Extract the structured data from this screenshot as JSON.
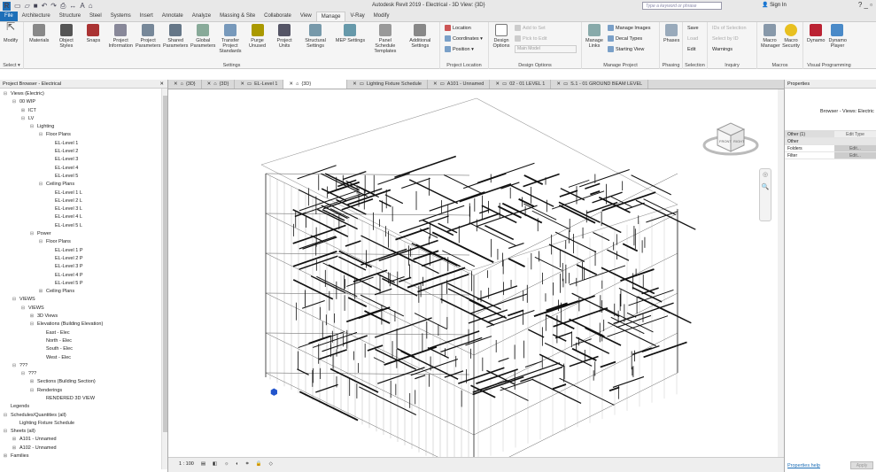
{
  "app": {
    "title": "Autodesk Revit 2019 - Electrical - 3D View: {3D}",
    "search_placeholder": "Type a keyword or phrase",
    "sign_in": "Sign In"
  },
  "ribbon_tabs": [
    "File",
    "Architecture",
    "Structure",
    "Steel",
    "Systems",
    "Insert",
    "Annotate",
    "Analyze",
    "Massing & Site",
    "Collaborate",
    "View",
    "Manage",
    "V-Ray",
    "Modify"
  ],
  "active_tab": "Manage",
  "panels": {
    "select": {
      "label": "Select ▾",
      "buttons": [
        "Modify"
      ]
    },
    "settings": {
      "label": "Settings",
      "buttons": [
        "Materials",
        "Object Styles",
        "Snaps",
        "Project Information",
        "Project Parameters",
        "Shared Parameters",
        "Global Parameters",
        "Transfer Project Standards",
        "Purge Unused",
        "Project Units",
        "Structural Settings",
        "MEP Settings",
        "Panel Schedule Templates",
        "Additional Settings"
      ]
    },
    "project_location": {
      "label": "Project Location",
      "items": [
        "Location",
        "Coordinates ▾",
        "Position ▾"
      ]
    },
    "design_options": {
      "label": "Design Options",
      "button": "Design Options",
      "items": [
        "Add to Set",
        "Pick to Edit"
      ],
      "dropdown": "Main Model"
    },
    "manage_project": {
      "label": "Manage Project",
      "button": "Manage Links",
      "items": [
        "Manage Images",
        "Decal Types",
        "Starting View"
      ]
    },
    "phasing": {
      "label": "Phasing",
      "button": "Phases"
    },
    "selection": {
      "label": "Selection",
      "items": [
        "Save",
        "Load",
        "Edit"
      ]
    },
    "inquiry": {
      "label": "Inquiry",
      "items": [
        "IDs of Selection",
        "Select by ID",
        "Warnings"
      ]
    },
    "macros": {
      "label": "Macros",
      "buttons": [
        "Macro Manager",
        "Macro Security"
      ]
    },
    "visual_programming": {
      "label": "Visual Programming",
      "buttons": [
        "Dynamo",
        "Dynamo Player"
      ]
    }
  },
  "project_browser": {
    "title": "Project Browser - Electrical",
    "items": [
      {
        "t": "Views (Electric)",
        "d": 0,
        "o": "-"
      },
      {
        "t": "00 WIP",
        "d": 1,
        "o": "-"
      },
      {
        "t": "ICT",
        "d": 2,
        "o": "+"
      },
      {
        "t": "LV",
        "d": 2,
        "o": "-"
      },
      {
        "t": "Lighting",
        "d": 3,
        "o": "-"
      },
      {
        "t": "Floor Plans",
        "d": 4,
        "o": "-"
      },
      {
        "t": "EL-Level 1",
        "d": 5
      },
      {
        "t": "EL-Level 2",
        "d": 5
      },
      {
        "t": "EL-Level 3",
        "d": 5
      },
      {
        "t": "EL-Level 4",
        "d": 5
      },
      {
        "t": "EL-Level 5",
        "d": 5
      },
      {
        "t": "Ceiling Plans",
        "d": 4,
        "o": "-"
      },
      {
        "t": "EL-Level 1 L",
        "d": 5
      },
      {
        "t": "EL-Level 2 L",
        "d": 5
      },
      {
        "t": "EL-Level 3 L",
        "d": 5
      },
      {
        "t": "EL-Level 4 L",
        "d": 5
      },
      {
        "t": "EL-Level 5 L",
        "d": 5
      },
      {
        "t": "Power",
        "d": 3,
        "o": "-"
      },
      {
        "t": "Floor Plans",
        "d": 4,
        "o": "-"
      },
      {
        "t": "EL-Level 1 P",
        "d": 5
      },
      {
        "t": "EL-Level 2 P",
        "d": 5
      },
      {
        "t": "EL-Level 3 P",
        "d": 5
      },
      {
        "t": "EL-Level 4 P",
        "d": 5
      },
      {
        "t": "EL-Level 5 P",
        "d": 5
      },
      {
        "t": "Ceiling Plans",
        "d": 4,
        "o": "+"
      },
      {
        "t": "VIEWS",
        "d": 1,
        "o": "-"
      },
      {
        "t": "VIEWS",
        "d": 2,
        "o": "-"
      },
      {
        "t": "3D Views",
        "d": 3,
        "o": "+"
      },
      {
        "t": "Elevations (Building Elevation)",
        "d": 3,
        "o": "-"
      },
      {
        "t": "East - Elec",
        "d": 4
      },
      {
        "t": "North - Elec",
        "d": 4
      },
      {
        "t": "South - Elec",
        "d": 4
      },
      {
        "t": "West - Elec",
        "d": 4
      },
      {
        "t": "???",
        "d": 1,
        "o": "-"
      },
      {
        "t": "???",
        "d": 2,
        "o": "-"
      },
      {
        "t": "Sections (Building Section)",
        "d": 3,
        "o": "+"
      },
      {
        "t": "Renderings",
        "d": 3,
        "o": "-"
      },
      {
        "t": "RENDERED 3D VIEW",
        "d": 4
      },
      {
        "t": "Legends",
        "d": 0
      },
      {
        "t": "Schedules/Quantities (all)",
        "d": 0,
        "o": "-"
      },
      {
        "t": "Lighting Fixture Schedule",
        "d": 1
      },
      {
        "t": "Sheets (all)",
        "d": 0,
        "o": "-"
      },
      {
        "t": "A101 - Unnamed",
        "d": 1,
        "o": "+"
      },
      {
        "t": "A102 - Unnamed",
        "d": 1,
        "o": "+"
      },
      {
        "t": "Families",
        "d": 0,
        "o": "+"
      }
    ]
  },
  "view_tabs": [
    {
      "t": "{3D}"
    },
    {
      "t": "{3D}"
    },
    {
      "t": "EL-Level 1"
    },
    {
      "t": "{3D}",
      "active": true
    },
    {
      "t": "Lighting Fixture Schedule"
    },
    {
      "t": "A101 - Unnamed"
    },
    {
      "t": "02 - 01 LEVEL 1"
    },
    {
      "t": "S.1 - 01 GROUND BEAM LEVEL"
    }
  ],
  "status": {
    "scale": "1 : 100"
  },
  "viewcube": {
    "faces": [
      "FRONT",
      "RIGHT"
    ]
  },
  "properties": {
    "title": "Properties",
    "type": "Browser - Views: Electric",
    "filter": "Other (1)",
    "edit_type": "Edit Type",
    "group": "Other",
    "rows": [
      {
        "k": "Folders",
        "v": "Edit..."
      },
      {
        "k": "Filter",
        "v": "Edit..."
      }
    ],
    "help": "Properties help",
    "apply": "Apply"
  }
}
